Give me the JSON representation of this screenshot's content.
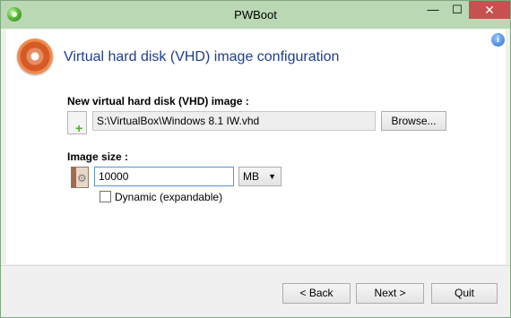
{
  "window": {
    "title": "PWBoot"
  },
  "titlebar": {
    "minimize": "—",
    "maximize": "☐",
    "close": "✕"
  },
  "header": {
    "title": "Virtual hard disk (VHD) image configuration",
    "info_icon": "i"
  },
  "vhd": {
    "label": "New virtual hard disk (VHD) image :",
    "path": "S:\\VirtualBox\\Windows 8.1 IW.vhd",
    "browse_label": "Browse..."
  },
  "image_size": {
    "label": "Image size :",
    "value": "10000",
    "unit": "MB",
    "dynamic_label": "Dynamic (expandable)",
    "dynamic_checked": false
  },
  "footer": {
    "back_label": "< Back",
    "next_label": "Next >",
    "quit_label": "Quit"
  },
  "colors": {
    "titlebar": "#b9d8b3",
    "accent_title": "#1e3d8c",
    "close_button": "#c75050"
  }
}
